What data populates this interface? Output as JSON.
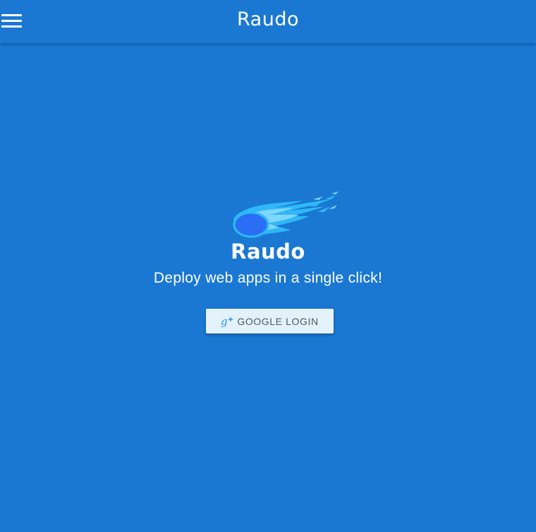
{
  "header": {
    "menu_icon": "hamburger-menu-icon",
    "title": "Raudo"
  },
  "hero": {
    "logo_icon": "comet-logo-icon",
    "title": "Raudo",
    "tagline": "Deploy web apps in a single click!"
  },
  "login": {
    "icon": "google-plus-icon",
    "label": "GOOGLE LOGIN"
  },
  "colors": {
    "background": "#1a78d2",
    "button_bg": "#e3f1fb",
    "comet_core": "#2a6ef5",
    "comet_flame": "#2fb8f7"
  }
}
